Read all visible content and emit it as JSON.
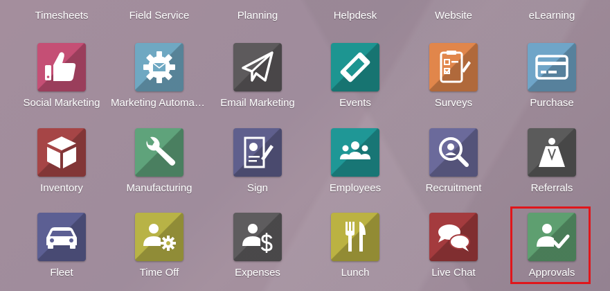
{
  "top_row": [
    "Timesheets",
    "Field Service",
    "Planning",
    "Helpdesk",
    "Website",
    "eLearning"
  ],
  "apps": [
    {
      "label": "Social Marketing",
      "icon": "thumbs-up-icon",
      "color": "#c54f75"
    },
    {
      "label": "Marketing Automat…",
      "icon": "gear-envelope-icon",
      "color": "#6fa8c2"
    },
    {
      "label": "Email Marketing",
      "icon": "paper-plane-icon",
      "color": "#5d5a5c"
    },
    {
      "label": "Events",
      "icon": "ticket-icon",
      "color": "#1d9591"
    },
    {
      "label": "Surveys",
      "icon": "clipboard-check-icon",
      "color": "#e1864b"
    },
    {
      "label": "Purchase",
      "icon": "credit-card-icon",
      "color": "#6fa5c8"
    },
    {
      "label": "Inventory",
      "icon": "box-icon",
      "color": "#a64546"
    },
    {
      "label": "Manufacturing",
      "icon": "wrench-icon",
      "color": "#5fa37b"
    },
    {
      "label": "Sign",
      "icon": "signed-document-icon",
      "color": "#5f5f8d"
    },
    {
      "label": "Employees",
      "icon": "people-group-icon",
      "color": "#1f9796"
    },
    {
      "label": "Recruitment",
      "icon": "magnifier-person-icon",
      "color": "#6b6a9b"
    },
    {
      "label": "Referrals",
      "icon": "superhero-icon",
      "color": "#5b5b5b"
    },
    {
      "label": "Fleet",
      "icon": "car-icon",
      "color": "#5c5f93"
    },
    {
      "label": "Time Off",
      "icon": "person-gear-icon",
      "color": "#b8b346"
    },
    {
      "label": "Expenses",
      "icon": "person-dollar-icon",
      "color": "#5e5c5e"
    },
    {
      "label": "Lunch",
      "icon": "fork-knife-icon",
      "color": "#bbb242"
    },
    {
      "label": "Live Chat",
      "icon": "chat-bubbles-icon",
      "color": "#a43b3e"
    },
    {
      "label": "Approvals",
      "icon": "person-check-icon",
      "color": "#5e9f70"
    }
  ],
  "highlight": {
    "color": "#e0161b",
    "target": "Approvals"
  }
}
